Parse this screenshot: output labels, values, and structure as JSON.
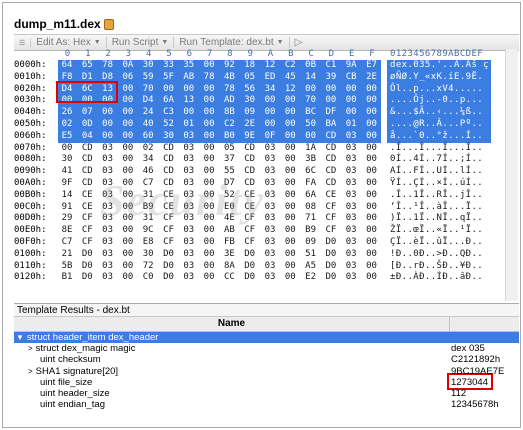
{
  "window": {
    "tab_title": "dump_m11.dex"
  },
  "toolbar": {
    "edit_as": "Edit As: Hex",
    "run_script": "Run Script",
    "run_template": "Run Template: dex.bt",
    "play_glyph": "▷"
  },
  "hex": {
    "col_headers": [
      "0",
      "1",
      "2",
      "3",
      "4",
      "5",
      "6",
      "7",
      "8",
      "9",
      "A",
      "B",
      "C",
      "D",
      "E",
      "F"
    ],
    "ascii_header": "0123456789ABCDEF",
    "rows": [
      {
        "addr": "0000h:",
        "bytes": [
          "64",
          "65",
          "78",
          "0A",
          "30",
          "33",
          "35",
          "00",
          "92",
          "18",
          "12",
          "C2",
          "0B",
          "C1",
          "9A",
          "E7"
        ],
        "ascii": "dex.035.'..Â.Áš ç",
        "sel": true
      },
      {
        "addr": "0010h:",
        "bytes": [
          "F8",
          "D1",
          "D8",
          "06",
          "59",
          "5F",
          "AB",
          "78",
          "4B",
          "05",
          "ED",
          "45",
          "14",
          "39",
          "CB",
          "2E"
        ],
        "ascii": "øÑØ.Y_«xK.íE.9Ë.",
        "sel": true
      },
      {
        "addr": "0020h:",
        "bytes": [
          "D4",
          "6C",
          "13",
          "00",
          "70",
          "00",
          "00",
          "00",
          "78",
          "56",
          "34",
          "12",
          "00",
          "00",
          "00",
          "00"
        ],
        "ascii": "Ôl..p...xV4.....",
        "sel": true
      },
      {
        "addr": "0030h:",
        "bytes": [
          "00",
          "00",
          "00",
          "00",
          "D4",
          "6A",
          "13",
          "00",
          "AD",
          "30",
          "00",
          "00",
          "70",
          "00",
          "00",
          "00"
        ],
        "ascii": "....Ôj..-0..p...",
        "sel": true
      },
      {
        "addr": "0040h:",
        "bytes": [
          "26",
          "07",
          "00",
          "00",
          "24",
          "C3",
          "00",
          "00",
          "8B",
          "09",
          "00",
          "00",
          "BC",
          "DF",
          "00",
          "00"
        ],
        "ascii": "&...$Ã..‹...¼ß..",
        "sel": true
      },
      {
        "addr": "0050h:",
        "bytes": [
          "02",
          "0D",
          "00",
          "00",
          "40",
          "52",
          "01",
          "00",
          "C2",
          "2E",
          "00",
          "00",
          "50",
          "BA",
          "01",
          "00"
        ],
        "ascii": "....@R..Â...Pº..",
        "sel": true
      },
      {
        "addr": "0060h:",
        "bytes": [
          "E5",
          "04",
          "00",
          "00",
          "60",
          "30",
          "03",
          "00",
          "B0",
          "9E",
          "0F",
          "00",
          "00",
          "CD",
          "03",
          "00"
        ],
        "ascii": "å...`0..°ž...Í..",
        "sel": true
      },
      {
        "addr": "0070h:",
        "bytes": [
          "00",
          "CD",
          "03",
          "00",
          "02",
          "CD",
          "03",
          "00",
          "05",
          "CD",
          "03",
          "00",
          "1A",
          "CD",
          "03",
          "00"
        ],
        "ascii": ".Í...Í...Í...Í..",
        "sel": false
      },
      {
        "addr": "0080h:",
        "bytes": [
          "30",
          "CD",
          "03",
          "00",
          "34",
          "CD",
          "03",
          "00",
          "37",
          "CD",
          "03",
          "00",
          "3B",
          "CD",
          "03",
          "00"
        ],
        "ascii": "0Í..4Í..7Í..;Í..",
        "sel": false
      },
      {
        "addr": "0090h:",
        "bytes": [
          "41",
          "CD",
          "03",
          "00",
          "46",
          "CD",
          "03",
          "00",
          "55",
          "CD",
          "03",
          "00",
          "6C",
          "CD",
          "03",
          "00"
        ],
        "ascii": "AÍ..FÍ..UÍ..lÍ..",
        "sel": false
      },
      {
        "addr": "00A0h:",
        "bytes": [
          "9F",
          "CD",
          "03",
          "00",
          "C7",
          "CD",
          "03",
          "00",
          "D7",
          "CD",
          "03",
          "00",
          "FA",
          "CD",
          "03",
          "00"
        ],
        "ascii": "ŸÍ..ÇÍ..×Í..úÍ..",
        "sel": false
      },
      {
        "addr": "00B0h:",
        "bytes": [
          "14",
          "CE",
          "03",
          "00",
          "31",
          "CE",
          "03",
          "00",
          "52",
          "CE",
          "03",
          "00",
          "6A",
          "CE",
          "03",
          "00"
        ],
        "ascii": ".Î..1Î..RÎ..jÎ..",
        "sel": false
      },
      {
        "addr": "00C0h:",
        "bytes": [
          "91",
          "CE",
          "03",
          "00",
          "B9",
          "CE",
          "03",
          "00",
          "E0",
          "CE",
          "03",
          "00",
          "08",
          "CF",
          "03",
          "00"
        ],
        "ascii": "‘Î..¹Î..àÎ...Ï..",
        "sel": false
      },
      {
        "addr": "00D0h:",
        "bytes": [
          "29",
          "CF",
          "03",
          "00",
          "31",
          "CF",
          "03",
          "00",
          "4E",
          "CF",
          "03",
          "00",
          "71",
          "CF",
          "03",
          "00"
        ],
        "ascii": ")Ï..1Ï..NÏ..qÏ..",
        "sel": false
      },
      {
        "addr": "00E0h:",
        "bytes": [
          "8E",
          "CF",
          "03",
          "00",
          "9C",
          "CF",
          "03",
          "00",
          "AB",
          "CF",
          "03",
          "00",
          "B9",
          "CF",
          "03",
          "00"
        ],
        "ascii": "ŽÏ..œÏ..«Ï..¹Ï..",
        "sel": false
      },
      {
        "addr": "00F0h:",
        "bytes": [
          "C7",
          "CF",
          "03",
          "00",
          "E8",
          "CF",
          "03",
          "00",
          "FB",
          "CF",
          "03",
          "00",
          "09",
          "D0",
          "03",
          "00"
        ],
        "ascii": "ÇÏ..èÏ..ûÏ...Ð..",
        "sel": false
      },
      {
        "addr": "0100h:",
        "bytes": [
          "21",
          "D0",
          "03",
          "00",
          "30",
          "D0",
          "03",
          "00",
          "3E",
          "D0",
          "03",
          "00",
          "51",
          "D0",
          "03",
          "00"
        ],
        "ascii": "!Ð..0Ð..>Ð..QÐ..",
        "sel": false
      },
      {
        "addr": "0110h:",
        "bytes": [
          "5B",
          "D0",
          "03",
          "00",
          "72",
          "D0",
          "03",
          "00",
          "8A",
          "D0",
          "03",
          "00",
          "A5",
          "D0",
          "03",
          "00"
        ],
        "ascii": "[Ð..rÐ..ŠÐ..¥Ð..",
        "sel": false
      },
      {
        "addr": "0120h:",
        "bytes": [
          "B1",
          "D0",
          "03",
          "00",
          "C0",
          "D0",
          "03",
          "00",
          "CC",
          "D0",
          "03",
          "00",
          "E2",
          "D0",
          "03",
          "00"
        ],
        "ascii": "±Ð..ÀÐ..ÌÐ..âÐ..",
        "sel": false
      }
    ]
  },
  "template_panel": {
    "title": "Template Results - dex.bt",
    "column_name": "Name",
    "rows": [
      {
        "name": "struct header_item dex_header",
        "value": "",
        "indent": 0,
        "chev": "▼",
        "selected": true
      },
      {
        "name": "struct dex_magic magic",
        "value": "dex 035",
        "indent": 1,
        "chev": ">",
        "selected": false
      },
      {
        "name": "uint checksum",
        "value": "C2121892h",
        "indent": 1,
        "chev": "",
        "selected": false
      },
      {
        "name": "SHA1 signature[20]",
        "value": "9BC19AE7E",
        "indent": 1,
        "chev": ">",
        "selected": false
      },
      {
        "name": "uint file_size",
        "value": "1273044",
        "indent": 1,
        "chev": "",
        "selected": false
      },
      {
        "name": "uint header_size",
        "value": "112",
        "indent": 1,
        "chev": "",
        "selected": false
      },
      {
        "name": "uint endian_tag",
        "value": "12345678h",
        "indent": 1,
        "chev": "",
        "selected": false
      }
    ]
  },
  "watermark": "Security"
}
